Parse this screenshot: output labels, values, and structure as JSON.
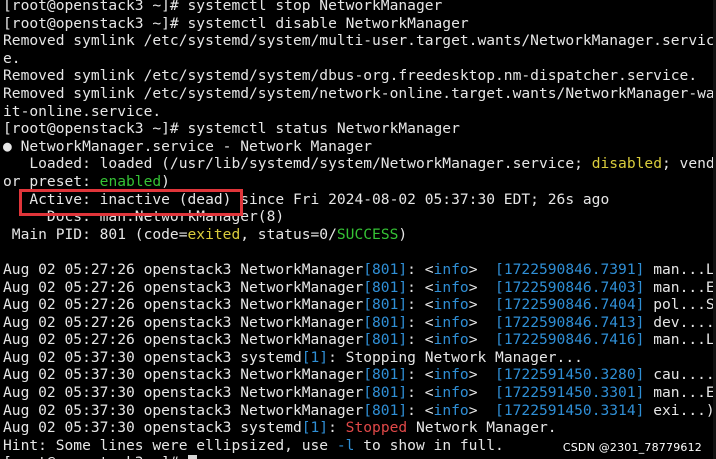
{
  "terminal": {
    "lines": [
      {
        "segments": [
          {
            "text": "[root@openstack3 ~]# systemctl stop NetworkManager",
            "color": "default"
          }
        ]
      },
      {
        "segments": [
          {
            "text": "[root@openstack3 ~]# systemctl disable NetworkManager",
            "color": "default"
          }
        ]
      },
      {
        "segments": [
          {
            "text": "Removed symlink /etc/systemd/system/multi-user.target.wants/NetworkManager.servic",
            "color": "default"
          }
        ]
      },
      {
        "segments": [
          {
            "text": "e.",
            "color": "default"
          }
        ]
      },
      {
        "segments": [
          {
            "text": "Removed symlink /etc/systemd/system/dbus-org.freedesktop.nm-dispatcher.service.",
            "color": "default"
          }
        ]
      },
      {
        "segments": [
          {
            "text": "Removed symlink /etc/systemd/system/network-online.target.wants/NetworkManager-wa",
            "color": "default"
          }
        ]
      },
      {
        "segments": [
          {
            "text": "it-online.service.",
            "color": "default"
          }
        ]
      },
      {
        "segments": [
          {
            "text": "[root@openstack3 ~]# systemctl status NetworkManager",
            "color": "default"
          }
        ]
      },
      {
        "segments": [
          {
            "text": "● NetworkManager.service - Network Manager",
            "color": "default"
          }
        ]
      },
      {
        "segments": [
          {
            "text": "   Loaded: loaded (/usr/lib/systemd/system/NetworkManager.service; ",
            "color": "default"
          },
          {
            "text": "disabled",
            "color": "yellow"
          },
          {
            "text": "; vend",
            "color": "default"
          }
        ]
      },
      {
        "segments": [
          {
            "text": "or preset: ",
            "color": "default"
          },
          {
            "text": "enabled",
            "color": "green"
          },
          {
            "text": ")",
            "color": "default"
          }
        ]
      },
      {
        "segments": [
          {
            "text": "   Active: inactive (dead) since Fri 2024-08-02 05:37:30 EDT; 26s ago",
            "color": "default"
          }
        ]
      },
      {
        "segments": [
          {
            "text": "     Docs: man:NetworkManager(8)",
            "color": "default"
          }
        ]
      },
      {
        "segments": [
          {
            "text": " Main PID: 801 (code=",
            "color": "default"
          },
          {
            "text": "exited",
            "color": "yellow"
          },
          {
            "text": ", status=0/",
            "color": "default"
          },
          {
            "text": "SUCCESS",
            "color": "green"
          },
          {
            "text": ")",
            "color": "default"
          }
        ]
      },
      {
        "segments": [
          {
            "text": "",
            "color": "default"
          }
        ]
      },
      {
        "segments": [
          {
            "text": "Aug 02 05:27:26 openstack3 NetworkManager",
            "color": "default"
          },
          {
            "text": "[801]",
            "color": "blue"
          },
          {
            "text": ": <",
            "color": "default"
          },
          {
            "text": "info",
            "color": "blue"
          },
          {
            "text": ">  ",
            "color": "default"
          },
          {
            "text": "[1722590846.7391]",
            "color": "blue"
          },
          {
            "text": " man...L",
            "color": "default"
          }
        ]
      },
      {
        "segments": [
          {
            "text": "Aug 02 05:27:26 openstack3 NetworkManager",
            "color": "default"
          },
          {
            "text": "[801]",
            "color": "blue"
          },
          {
            "text": ": <",
            "color": "default"
          },
          {
            "text": "info",
            "color": "blue"
          },
          {
            "text": ">  ",
            "color": "default"
          },
          {
            "text": "[1722590846.7403]",
            "color": "blue"
          },
          {
            "text": " man...E",
            "color": "default"
          }
        ]
      },
      {
        "segments": [
          {
            "text": "Aug 02 05:27:26 openstack3 NetworkManager",
            "color": "default"
          },
          {
            "text": "[801]",
            "color": "blue"
          },
          {
            "text": ": <",
            "color": "default"
          },
          {
            "text": "info",
            "color": "blue"
          },
          {
            "text": ">  ",
            "color": "default"
          },
          {
            "text": "[1722590846.7404]",
            "color": "blue"
          },
          {
            "text": " pol...S",
            "color": "default"
          }
        ]
      },
      {
        "segments": [
          {
            "text": "Aug 02 05:27:26 openstack3 NetworkManager",
            "color": "default"
          },
          {
            "text": "[801]",
            "color": "blue"
          },
          {
            "text": ": <",
            "color": "default"
          },
          {
            "text": "info",
            "color": "blue"
          },
          {
            "text": ">  ",
            "color": "default"
          },
          {
            "text": "[1722590846.7413]",
            "color": "blue"
          },
          {
            "text": " dev....",
            "color": "default"
          }
        ]
      },
      {
        "segments": [
          {
            "text": "Aug 02 05:27:26 openstack3 NetworkManager",
            "color": "default"
          },
          {
            "text": "[801]",
            "color": "blue"
          },
          {
            "text": ": <",
            "color": "default"
          },
          {
            "text": "info",
            "color": "blue"
          },
          {
            "text": ">  ",
            "color": "default"
          },
          {
            "text": "[1722590846.7416]",
            "color": "blue"
          },
          {
            "text": " man...L",
            "color": "default"
          }
        ]
      },
      {
        "segments": [
          {
            "text": "Aug 02 05:37:30 openstack3 systemd",
            "color": "default"
          },
          {
            "text": "[1]",
            "color": "blue"
          },
          {
            "text": ": Stopping Network Manager...",
            "color": "default"
          }
        ]
      },
      {
        "segments": [
          {
            "text": "Aug 02 05:37:30 openstack3 NetworkManager",
            "color": "default"
          },
          {
            "text": "[801]",
            "color": "blue"
          },
          {
            "text": ": <",
            "color": "default"
          },
          {
            "text": "info",
            "color": "blue"
          },
          {
            "text": ">  ",
            "color": "default"
          },
          {
            "text": "[1722591450.3280]",
            "color": "blue"
          },
          {
            "text": " cau....",
            "color": "default"
          }
        ]
      },
      {
        "segments": [
          {
            "text": "Aug 02 05:37:30 openstack3 NetworkManager",
            "color": "default"
          },
          {
            "text": "[801]",
            "color": "blue"
          },
          {
            "text": ": <",
            "color": "default"
          },
          {
            "text": "info",
            "color": "blue"
          },
          {
            "text": ">  ",
            "color": "default"
          },
          {
            "text": "[1722591450.3301]",
            "color": "blue"
          },
          {
            "text": " man...E",
            "color": "default"
          }
        ]
      },
      {
        "segments": [
          {
            "text": "Aug 02 05:37:30 openstack3 NetworkManager",
            "color": "default"
          },
          {
            "text": "[801]",
            "color": "blue"
          },
          {
            "text": ": <",
            "color": "default"
          },
          {
            "text": "info",
            "color": "blue"
          },
          {
            "text": ">  ",
            "color": "default"
          },
          {
            "text": "[1722591450.3314]",
            "color": "blue"
          },
          {
            "text": " exi...)",
            "color": "default"
          }
        ]
      },
      {
        "segments": [
          {
            "text": "Aug 02 05:37:30 openstack3 systemd",
            "color": "default"
          },
          {
            "text": "[1]",
            "color": "blue"
          },
          {
            "text": ": ",
            "color": "default"
          },
          {
            "text": "Stopped",
            "color": "red"
          },
          {
            "text": " Network Manager.",
            "color": "default"
          }
        ]
      },
      {
        "segments": [
          {
            "text": "Hint: Some lines were ellipsized, use ",
            "color": "default"
          },
          {
            "text": "-l",
            "color": "blue"
          },
          {
            "text": " to show in full.",
            "color": "default"
          }
        ]
      },
      {
        "segments": [
          {
            "text": "[root@openstack3 ~]# ",
            "color": "default"
          }
        ],
        "cursor": true
      }
    ]
  },
  "watermark": {
    "text": "CSDN @2301_78779612"
  },
  "colors": {
    "background": "#000000",
    "default": "#e6e6e6",
    "yellow": "#d9cc3c",
    "green": "#35c235",
    "blue": "#2f8fd6",
    "red": "#e04848",
    "highlight_box": "#e0353a"
  }
}
